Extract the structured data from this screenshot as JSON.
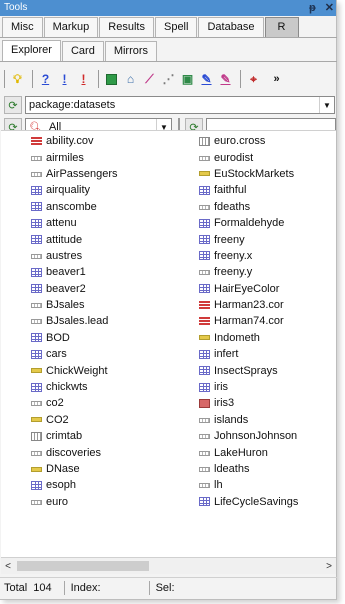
{
  "window": {
    "title": "Tools",
    "pin": "ᵖ",
    "close": "✕"
  },
  "tabs_row1": [
    "Misc",
    "Markup",
    "Results",
    "Spell",
    "Database",
    "R"
  ],
  "tabs_row2": [
    "Explorer",
    "Card",
    "Mirrors"
  ],
  "toolbar": {
    "icons": [
      "lightbulb-icon",
      "help-icon",
      "warning-icon",
      "error-icon",
      "run-icon",
      "build-icon",
      "chart-icon",
      "matrix-icon",
      "window-icon",
      "pen-icon",
      "pen-alt-icon",
      "crosshair-icon"
    ],
    "overflow": "»"
  },
  "package_combo": {
    "value": "package:datasets"
  },
  "filter": {
    "selected": "All",
    "text": ""
  },
  "datasets": {
    "col1": [
      {
        "name": "ability.cov",
        "type": "list"
      },
      {
        "name": "airmiles",
        "type": "ts"
      },
      {
        "name": "AirPassengers",
        "type": "ts"
      },
      {
        "name": "airquality",
        "type": "df"
      },
      {
        "name": "anscombe",
        "type": "df"
      },
      {
        "name": "attenu",
        "type": "df"
      },
      {
        "name": "attitude",
        "type": "df"
      },
      {
        "name": "austres",
        "type": "ts"
      },
      {
        "name": "beaver1",
        "type": "df"
      },
      {
        "name": "beaver2",
        "type": "df"
      },
      {
        "name": "BJsales",
        "type": "ts"
      },
      {
        "name": "BJsales.lead",
        "type": "ts"
      },
      {
        "name": "BOD",
        "type": "df"
      },
      {
        "name": "cars",
        "type": "df"
      },
      {
        "name": "ChickWeight",
        "type": "fac"
      },
      {
        "name": "chickwts",
        "type": "df"
      },
      {
        "name": "co2",
        "type": "ts"
      },
      {
        "name": "CO2",
        "type": "fac"
      },
      {
        "name": "crimtab",
        "type": "tab"
      },
      {
        "name": "discoveries",
        "type": "ts"
      },
      {
        "name": "DNase",
        "type": "fac"
      },
      {
        "name": "esoph",
        "type": "df"
      },
      {
        "name": "euro",
        "type": "ts"
      }
    ],
    "col2": [
      {
        "name": "euro.cross",
        "type": "tab"
      },
      {
        "name": "eurodist",
        "type": "ts"
      },
      {
        "name": "EuStockMarkets",
        "type": "fac"
      },
      {
        "name": "faithful",
        "type": "df"
      },
      {
        "name": "fdeaths",
        "type": "ts"
      },
      {
        "name": "Formaldehyde",
        "type": "df"
      },
      {
        "name": "freeny",
        "type": "df"
      },
      {
        "name": "freeny.x",
        "type": "df"
      },
      {
        "name": "freeny.y",
        "type": "ts"
      },
      {
        "name": "HairEyeColor",
        "type": "df"
      },
      {
        "name": "Harman23.cor",
        "type": "list"
      },
      {
        "name": "Harman74.cor",
        "type": "list"
      },
      {
        "name": "Indometh",
        "type": "fac"
      },
      {
        "name": "infert",
        "type": "df"
      },
      {
        "name": "InsectSprays",
        "type": "df"
      },
      {
        "name": "iris",
        "type": "df"
      },
      {
        "name": "iris3",
        "type": "arr"
      },
      {
        "name": "islands",
        "type": "ts"
      },
      {
        "name": "JohnsonJohnson",
        "type": "ts"
      },
      {
        "name": "LakeHuron",
        "type": "ts"
      },
      {
        "name": "ldeaths",
        "type": "ts"
      },
      {
        "name": "lh",
        "type": "ts"
      },
      {
        "name": "LifeCycleSavings",
        "type": "df"
      }
    ]
  },
  "status": {
    "total_label": "Total",
    "total_value": "104",
    "index_label": "Index:",
    "sel_label": "Sel:"
  },
  "colors": {
    "titlebar": "#4d8fd0",
    "panel": "#f3f3f3"
  }
}
